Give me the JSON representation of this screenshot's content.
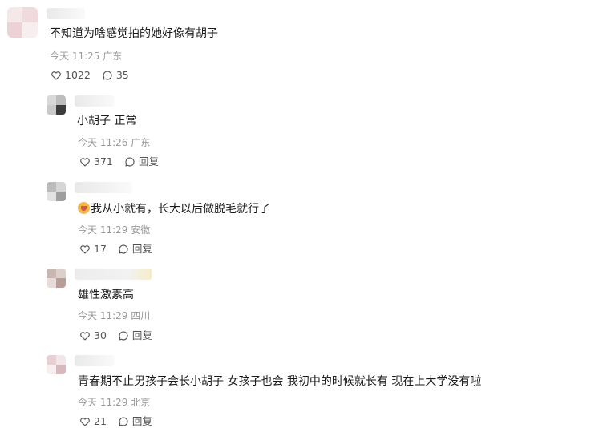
{
  "comments": [
    {
      "text": "不知道为啥感觉拍的她好像有胡子",
      "time": "今天 11:25",
      "location": "广东",
      "likes": "1022",
      "replies": "35"
    },
    {
      "text": "小胡子 正常",
      "time": "今天 11:26",
      "location": "广东",
      "likes": "371",
      "replies": "回复"
    },
    {
      "text": "我从小就有，长大以后做脱毛就行了",
      "time": "今天 11:29",
      "location": "安徽",
      "likes": "17",
      "replies": "回复"
    },
    {
      "text": "雄性激素高",
      "time": "今天 11:29",
      "location": "四川",
      "likes": "30",
      "replies": "回复"
    },
    {
      "text": "青春期不止男孩子会长小胡子 女孩子也会 我初中的时候就长有 现在上大学没有啦",
      "time": "今天 11:29",
      "location": "北京",
      "likes": "21",
      "replies": "回复"
    }
  ],
  "icons": {
    "like": "heart-icon",
    "reply": "comment-bubble-icon"
  }
}
